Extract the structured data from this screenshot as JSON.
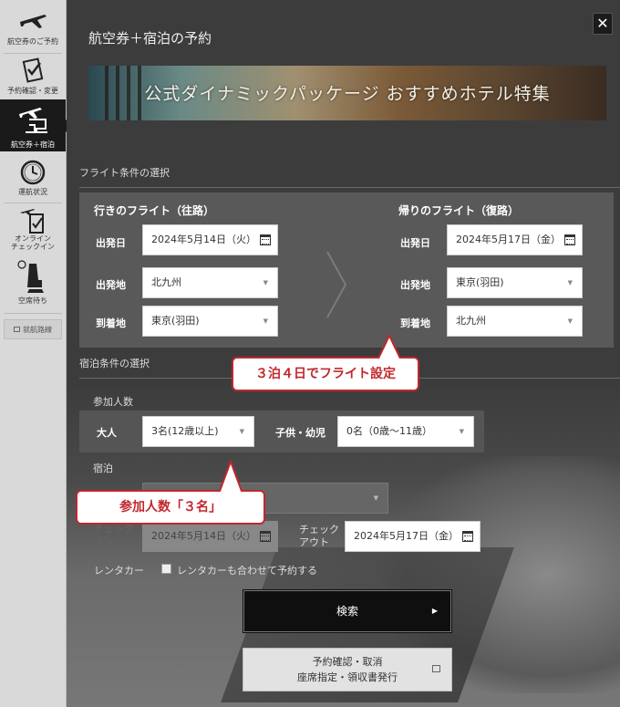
{
  "sidebar": {
    "items": [
      {
        "label": "航空券のご予約",
        "icon": "airplane-icon"
      },
      {
        "label": "予約確認・変更",
        "icon": "checklist-icon"
      },
      {
        "label": "航空券＋宿泊",
        "icon": "plane-hotel-icon"
      },
      {
        "label": "運航状況",
        "icon": "clock-icon"
      },
      {
        "label": "オンライン\nチェックイン",
        "icon": "checkin-icon"
      },
      {
        "label": "空席待ち",
        "icon": "seat-icon"
      }
    ],
    "route_label": "就航路線"
  },
  "header": {
    "title": "航空券＋宿泊の予約",
    "close": "✕"
  },
  "banner": {
    "text": "公式ダイナミックパッケージ おすすめホテル特集"
  },
  "flight": {
    "section_label": "フライト条件の選択",
    "outbound": {
      "heading": "行きのフライト（往路）",
      "date_label": "出発日",
      "date_value": "2024年5月14日（火）",
      "origin_label": "出発地",
      "origin_value": "北九州",
      "dest_label": "到着地",
      "dest_value": "東京(羽田)"
    },
    "return": {
      "heading": "帰りのフライト（復路）",
      "date_label": "出発日",
      "date_value": "2024年5月17日（金）",
      "origin_label": "出発地",
      "origin_value": "東京(羽田)",
      "dest_label": "到着地",
      "dest_value": "北九州"
    }
  },
  "callouts": {
    "flight": "３泊４日でフライト設定",
    "guests": "参加人数「３名」"
  },
  "stay": {
    "section_label": "宿泊条件の選択",
    "guests_label": "参加人数",
    "adult_label": "大人",
    "adult_value": "3名(12歳以上)",
    "child_label": "子供・幼児",
    "child_value": "0名（0歳～11歳）",
    "lodging_label": "宿泊",
    "checkin_label": "チェック\nイン",
    "checkin_value": "2024年5月14日（火）",
    "checkout_label": "チェック\nアウト",
    "checkout_value": "2024年5月17日（金）",
    "rental_label": "レンタカー",
    "rental_checkbox": "レンタカーも合わせて予約する"
  },
  "buttons": {
    "search": "検索",
    "confirm_line1": "予約確認・取消",
    "confirm_line2": "座席指定・領収書発行"
  },
  "colors": {
    "callout": "#c2272d",
    "panel": "#595959",
    "search_bg": "#0f0f0f"
  }
}
